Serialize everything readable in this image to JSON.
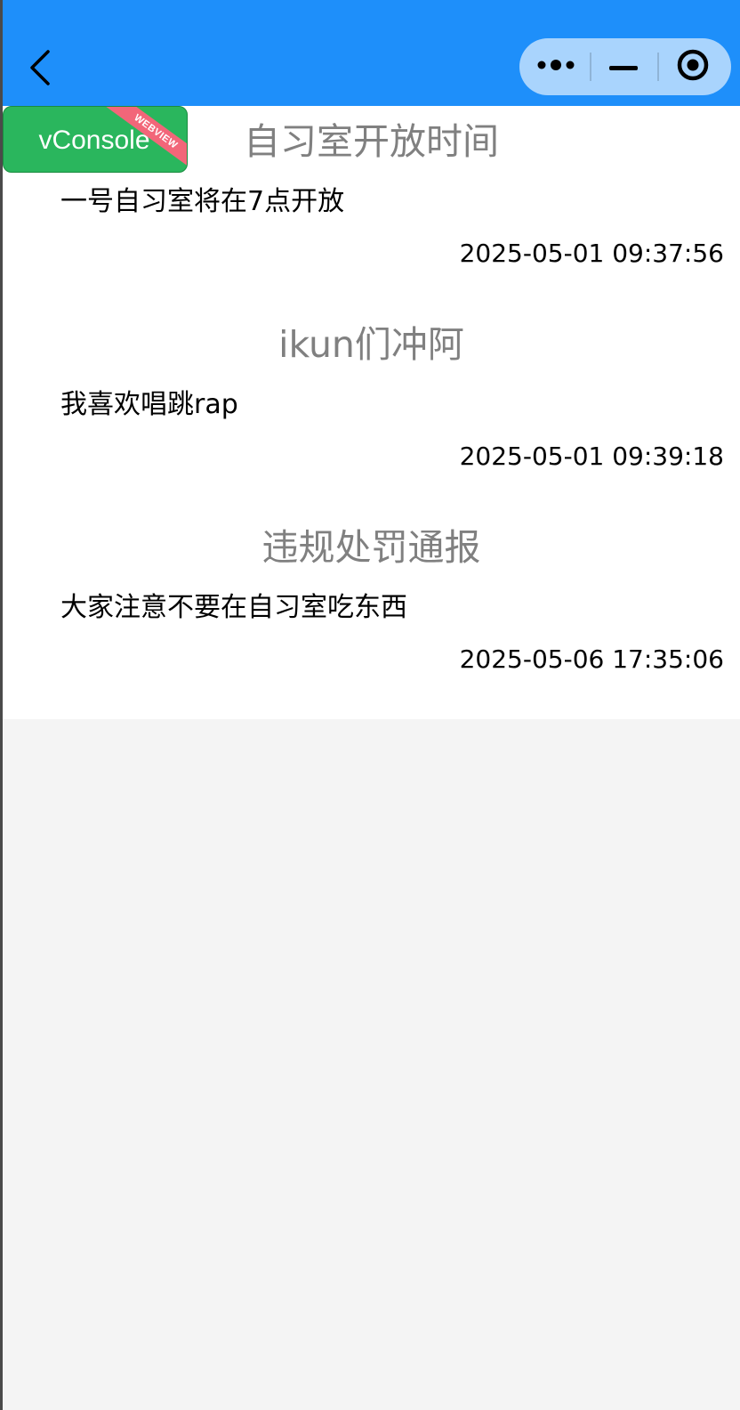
{
  "nav": {
    "back_icon": "chevron-left-icon",
    "capsule": {
      "more_icon": "more-dots-icon",
      "minimize_icon": "minimize-icon",
      "close_icon": "target-circle-icon"
    },
    "colors": {
      "bar": "#1e8ffa",
      "capsule_bg": "rgba(255,255,255,0.62)"
    }
  },
  "vconsole": {
    "label": "vConsole",
    "ribbon": "WEBVIEW",
    "colors": {
      "button": "#2ab65d",
      "ribbon": "#f26679"
    }
  },
  "notices": [
    {
      "title": "自习室开放时间",
      "body": "一号自习室将在7点开放",
      "time": "2025-05-01 09:37:56"
    },
    {
      "title": "ikun们冲阿",
      "body": "我喜欢唱跳rap",
      "time": "2025-05-01 09:39:18"
    },
    {
      "title": "违规处罚通报",
      "body": "大家注意不要在自习室吃东西",
      "time": "2025-05-06 17:35:06"
    }
  ]
}
